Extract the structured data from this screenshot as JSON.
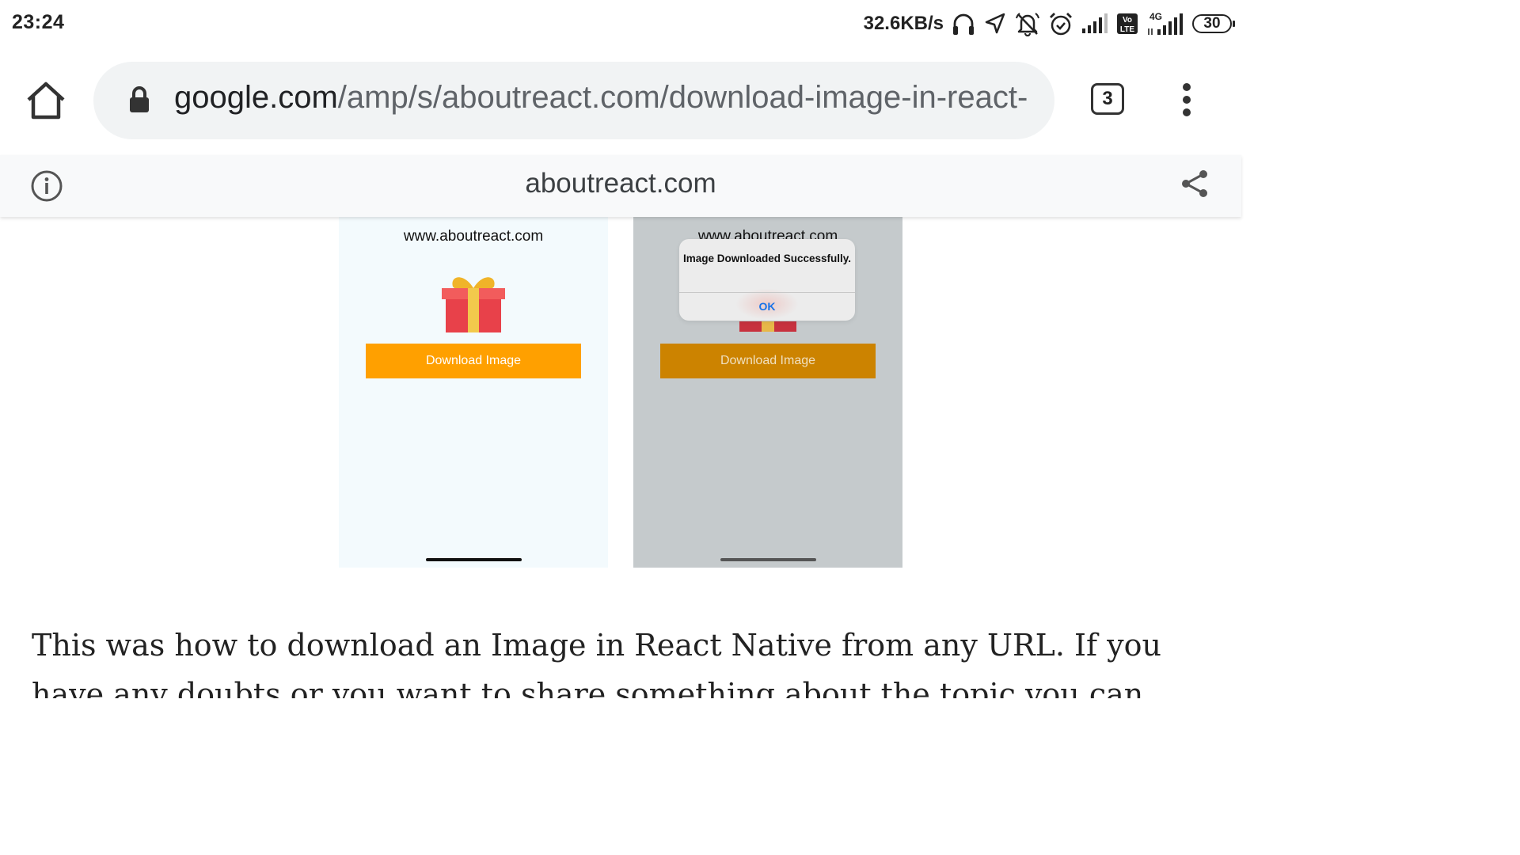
{
  "status_bar": {
    "time": "23:24",
    "net_speed": "32.6KB/s",
    "network_type": "4G",
    "volte": "Vo LTE",
    "battery": "30",
    "icons": [
      "headphones-icon",
      "location-icon",
      "muted-bell-icon",
      "alarm-icon",
      "signal-icon",
      "volte-icon",
      "signal-4g-icon",
      "battery-icon"
    ]
  },
  "toolbar": {
    "url_host": "google.com",
    "url_path": "/amp/s/aboutreact.com/download-image-in-react-",
    "tab_count": "3",
    "icons": [
      "home-icon",
      "lock-icon",
      "more-vert-icon"
    ]
  },
  "amp_header": {
    "domain": "aboutreact.com",
    "icons": [
      "info-icon",
      "share-icon"
    ]
  },
  "content": {
    "left_phone": {
      "site": "www.aboutreact.com",
      "button": "Download Image"
    },
    "right_phone": {
      "site": "www.aboutreact.com",
      "button": "Download Image",
      "alert": {
        "message": "Image Downloaded Successfully.",
        "ok": "OK"
      }
    },
    "article_text": "This was how to download an Image in React Native from any URL. If you have any doubts or you want to share something about the topic you can comment"
  },
  "colors": {
    "download_button": "#ffa000",
    "download_button_dimmed": "#cc8300",
    "alert_ok": "#1a73e8",
    "omnibox_bg": "#f1f3f4"
  }
}
